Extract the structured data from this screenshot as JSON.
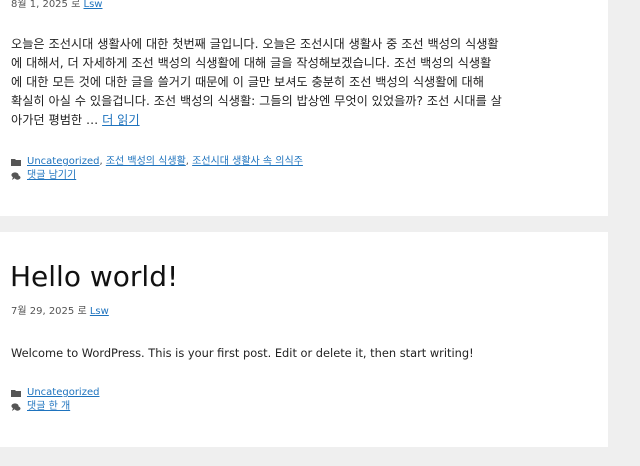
{
  "post1": {
    "date": "8월 1, 2025",
    "by": "로",
    "author": "Lsw",
    "excerpt_lines": [
      "오늘은 조선시대 생활사에 대한 첫번째 글입니다. 오늘은 조선시대 생활사 중 조선 백성의 식생활",
      "에 대해서, 더 자세하게 조선 백성의 식생활에 대해 글을 작성해보겠습니다. 조선 백성의 식생활",
      "에 대한 모든 것에 대한 글을 쓸거기 때문에 이 글만 보셔도 충분히 조선 백성의 식생활에 대해",
      "확실히 아실 수 있을겁니다. 조선 백성의 식생활: 그들의 밥상엔 무엇이 있었을까? 조선 시대를 살",
      "아가던 평범한 …"
    ],
    "read_more": "더 읽기",
    "categories": [
      "Uncategorized",
      "조선 백성의 식생활",
      "조선시대 생활사 속 의식주"
    ],
    "comment_link": "댓글 남기기"
  },
  "post2": {
    "title": "Hello world!",
    "date": "7월 29, 2025",
    "by": "로",
    "author": "Lsw",
    "body": "Welcome to WordPress. This is your first post. Edit or delete it, then start writing!",
    "categories": [
      "Uncategorized"
    ],
    "comment_link": "댓글 한 개"
  },
  "colors": {
    "page_bg": "#efefef",
    "card_bg": "#ffffff",
    "link": "#1e73be",
    "text": "#222222"
  },
  "icons": {
    "category": "folder-icon",
    "comment": "comment-icon"
  }
}
